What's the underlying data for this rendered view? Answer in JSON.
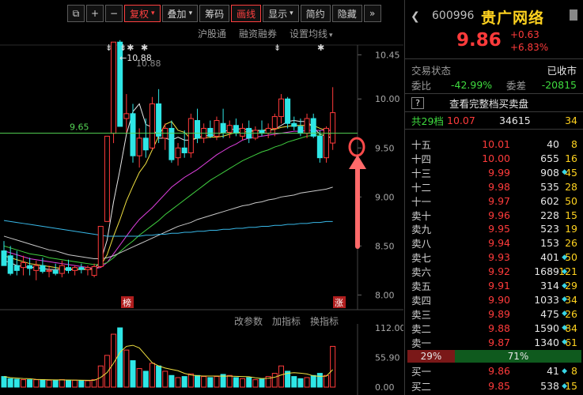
{
  "toolbar": {
    "restore_icon": "restore-icon",
    "zoom_in_icon": "plus-icon",
    "zoom_out_icon": "minus-icon",
    "fuquan": "复权",
    "diejia": "叠加",
    "chouma": "筹码",
    "huaxian": "画线",
    "xianshi": "显示",
    "jianyue": "简约",
    "yincang": "隐藏",
    "expand_icon": "double-chevron-right-icon",
    "caret": "▾"
  },
  "subtoolbar": {
    "hugutong": "沪股通",
    "rongzi": "融资融券",
    "shezhi": "设置均线"
  },
  "chart": {
    "y_ticks": [
      "10.45",
      "10.00",
      "9.50",
      "9.00",
      "8.50",
      "8.00"
    ],
    "high_label": "←10.88",
    "high_label_shadow": "10.88",
    "ref_line_label": "9.65",
    "badge_list": "榜",
    "badge_limit": "涨",
    "markers": [
      "⇟",
      "⇟✱",
      "✱",
      "⇟",
      "✱"
    ],
    "vol_ticks": [
      "112.00",
      "55.90",
      "0.00"
    ]
  },
  "chart_data": {
    "type": "candlestick",
    "y_range": [
      7.85,
      10.55
    ],
    "ref_price": 9.65,
    "candles": [
      [
        8.45,
        8.55,
        8.3,
        8.3
      ],
      [
        8.4,
        8.5,
        8.2,
        8.22
      ],
      [
        8.3,
        8.45,
        8.2,
        8.25
      ],
      [
        8.28,
        8.4,
        8.2,
        8.33
      ],
      [
        8.3,
        8.38,
        8.2,
        8.27
      ],
      [
        8.25,
        8.35,
        8.15,
        8.3
      ],
      [
        8.3,
        8.38,
        8.22,
        8.24
      ],
      [
        8.24,
        8.3,
        8.18,
        8.25
      ],
      [
        8.25,
        8.32,
        8.2,
        8.22
      ],
      [
        8.22,
        8.35,
        8.18,
        8.3
      ],
      [
        8.28,
        8.36,
        8.22,
        8.25
      ],
      [
        8.25,
        8.3,
        8.2,
        8.28
      ],
      [
        8.28,
        8.32,
        8.22,
        8.26
      ],
      [
        8.26,
        8.3,
        8.2,
        8.28
      ],
      [
        8.2,
        8.32,
        8.18,
        8.29
      ],
      [
        8.29,
        8.7,
        8.28,
        8.7
      ],
      [
        8.75,
        9.62,
        8.75,
        9.62
      ],
      [
        9.65,
        10.58,
        9.55,
        10.58
      ],
      [
        10.58,
        10.6,
        9.72,
        9.72
      ],
      [
        9.8,
        10.05,
        9.65,
        9.85
      ],
      [
        9.85,
        9.95,
        9.35,
        9.42
      ],
      [
        9.42,
        9.7,
        9.3,
        9.6
      ],
      [
        9.6,
        9.8,
        9.4,
        9.48
      ],
      [
        9.5,
        10.02,
        9.48,
        9.95
      ],
      [
        9.95,
        10.1,
        9.55,
        9.62
      ],
      [
        9.6,
        9.75,
        9.48,
        9.7
      ],
      [
        9.7,
        9.78,
        9.35,
        9.38
      ],
      [
        9.4,
        9.55,
        9.32,
        9.5
      ],
      [
        9.5,
        9.68,
        9.4,
        9.45
      ],
      [
        9.45,
        9.85,
        9.4,
        9.8
      ],
      [
        9.78,
        9.9,
        9.55,
        9.6
      ],
      [
        9.6,
        9.75,
        9.55,
        9.7
      ],
      [
        9.7,
        9.78,
        9.6,
        9.62
      ],
      [
        9.62,
        9.82,
        9.58,
        9.78
      ],
      [
        9.75,
        9.9,
        9.6,
        9.66
      ],
      [
        9.66,
        9.78,
        9.6,
        9.73
      ],
      [
        9.73,
        9.8,
        9.62,
        9.65
      ],
      [
        9.62,
        9.75,
        9.58,
        9.7
      ],
      [
        9.7,
        9.78,
        9.55,
        9.6
      ],
      [
        9.6,
        9.72,
        9.58,
        9.68
      ],
      [
        9.68,
        9.78,
        9.62,
        9.65
      ],
      [
        9.65,
        9.75,
        9.6,
        9.7
      ],
      [
        9.7,
        9.85,
        9.62,
        9.82
      ],
      [
        9.82,
        10.05,
        9.75,
        10.0
      ],
      [
        10.0,
        10.02,
        9.7,
        9.75
      ],
      [
        9.75,
        9.82,
        9.68,
        9.72
      ],
      [
        9.72,
        9.8,
        9.62,
        9.65
      ],
      [
        9.65,
        9.85,
        9.6,
        9.8
      ],
      [
        9.8,
        9.85,
        9.6,
        9.62
      ],
      [
        9.62,
        9.68,
        9.35,
        9.4
      ],
      [
        9.4,
        9.72,
        9.35,
        9.7
      ],
      [
        9.55,
        10.12,
        9.48,
        9.86
      ]
    ],
    "ma": [
      {
        "name": "MA5",
        "color": "#e8e8e8",
        "values": [
          8.35,
          8.33,
          8.3,
          8.29,
          8.28,
          8.28,
          8.27,
          8.26,
          8.26,
          8.26,
          8.26,
          8.26,
          8.26,
          8.27,
          8.27,
          8.34,
          8.56,
          8.95,
          9.28,
          9.64,
          9.87,
          9.95,
          9.74,
          9.71,
          9.6,
          9.6,
          9.58,
          9.61,
          9.58,
          9.58,
          9.6,
          9.63,
          9.62,
          9.64,
          9.66,
          9.69,
          9.69,
          9.7,
          9.68,
          9.68,
          9.68,
          9.68,
          9.69,
          9.73,
          9.77,
          9.78,
          9.77,
          9.77,
          9.71,
          9.64,
          9.62,
          9.6
        ]
      },
      {
        "name": "MA10",
        "color": "#f0e040",
        "values": [
          8.4,
          8.38,
          8.36,
          8.34,
          8.32,
          8.31,
          8.3,
          8.29,
          8.28,
          8.27,
          8.27,
          8.26,
          8.26,
          8.26,
          8.26,
          8.3,
          8.41,
          8.6,
          8.77,
          8.96,
          9.11,
          9.25,
          9.34,
          9.48,
          9.62,
          9.74,
          9.77,
          9.68,
          9.66,
          9.59,
          9.6,
          9.6,
          9.61,
          9.61,
          9.62,
          9.64,
          9.66,
          9.66,
          9.67,
          9.67,
          9.68,
          9.69,
          9.69,
          9.71,
          9.72,
          9.73,
          9.73,
          9.73,
          9.73,
          9.7,
          9.68,
          9.68
        ]
      },
      {
        "name": "MA20",
        "color": "#e040e0",
        "values": [
          8.45,
          8.43,
          8.41,
          8.39,
          8.37,
          8.36,
          8.35,
          8.34,
          8.33,
          8.32,
          8.31,
          8.3,
          8.29,
          8.28,
          8.27,
          8.28,
          8.33,
          8.42,
          8.51,
          8.6,
          8.69,
          8.77,
          8.83,
          8.89,
          8.96,
          9.03,
          9.1,
          9.15,
          9.2,
          9.24,
          9.28,
          9.33,
          9.38,
          9.43,
          9.47,
          9.51,
          9.54,
          9.58,
          9.6,
          9.61,
          9.62,
          9.63,
          9.64,
          9.65,
          9.66,
          9.67,
          9.67,
          9.68,
          9.68,
          9.68,
          9.68,
          9.68
        ]
      },
      {
        "name": "MA30",
        "color": "#40d040",
        "values": [
          8.5,
          8.48,
          8.46,
          8.44,
          8.42,
          8.41,
          8.4,
          8.38,
          8.37,
          8.36,
          8.35,
          8.34,
          8.33,
          8.32,
          8.31,
          8.31,
          8.33,
          8.38,
          8.44,
          8.5,
          8.55,
          8.61,
          8.66,
          8.71,
          8.76,
          8.82,
          8.87,
          8.92,
          8.97,
          9.02,
          9.07,
          9.12,
          9.17,
          9.21,
          9.25,
          9.29,
          9.33,
          9.37,
          9.4,
          9.43,
          9.46,
          9.48,
          9.51,
          9.53,
          9.56,
          9.58,
          9.6,
          9.62,
          9.63,
          9.63,
          9.64,
          9.64
        ]
      },
      {
        "name": "MA60",
        "color": "#c8c8c8",
        "values": [
          8.6,
          8.58,
          8.56,
          8.54,
          8.52,
          8.5,
          8.48,
          8.46,
          8.45,
          8.43,
          8.41,
          8.4,
          8.39,
          8.38,
          8.37,
          8.37,
          8.38,
          8.4,
          8.43,
          8.46,
          8.49,
          8.52,
          8.55,
          8.58,
          8.61,
          8.64,
          8.67,
          8.7,
          8.72,
          8.74,
          8.77,
          8.79,
          8.81,
          8.83,
          8.85,
          8.87,
          8.89,
          8.91,
          8.92,
          8.94,
          8.95,
          8.97,
          8.98,
          9.0,
          9.01,
          9.02,
          9.04,
          9.05,
          9.06,
          9.07,
          9.08,
          9.1
        ]
      },
      {
        "name": "MA120",
        "color": "#38b8e8",
        "values": [
          8.76,
          8.75,
          8.74,
          8.73,
          8.72,
          8.71,
          8.7,
          8.69,
          8.68,
          8.67,
          8.66,
          8.65,
          8.64,
          8.63,
          8.62,
          8.61,
          8.6,
          8.6,
          8.6,
          8.6,
          8.6,
          8.6,
          8.61,
          8.61,
          8.62,
          8.62,
          8.63,
          8.63,
          8.64,
          8.64,
          8.65,
          8.65,
          8.66,
          8.66,
          8.67,
          8.67,
          8.68,
          8.68,
          8.69,
          8.69,
          8.7,
          8.7,
          8.71,
          8.71,
          8.72,
          8.72,
          8.73,
          8.73,
          8.74,
          8.74,
          8.75,
          8.75
        ]
      }
    ],
    "volume": {
      "range": [
        0,
        112
      ],
      "values": [
        20,
        16,
        15,
        14,
        14,
        14,
        14,
        13,
        13,
        14,
        13,
        13,
        12,
        12,
        14,
        40,
        60,
        100,
        115,
        70,
        50,
        35,
        30,
        45,
        40,
        30,
        22,
        18,
        20,
        25,
        22,
        20,
        18,
        20,
        24,
        22,
        18,
        16,
        18,
        14,
        15,
        20,
        26,
        40,
        30,
        20,
        16,
        18,
        22,
        26,
        22,
        77
      ]
    }
  },
  "indicator_tools": {
    "gaicanshu": "改参数",
    "jiazhibiao": "加指标",
    "huanzhibiao": "换指标"
  },
  "panel": {
    "code": "600996",
    "name": "贵广网络",
    "price": "9.86",
    "change": "+0.63",
    "change_pct": "+6.83%",
    "status_label": "交易状态",
    "status_value": "已收市",
    "weibi_label": "委比",
    "weibi_value": "-42.99%",
    "weicha_label": "委差",
    "weicha_value": "-20815",
    "help_btn": "?",
    "full_depth": "查看完整档买卖盘",
    "summary": {
      "label": "共29档",
      "price": "10.07",
      "vol": "34615",
      "cnt": "34"
    },
    "asks": [
      {
        "label": "十五",
        "price": "10.01",
        "vol": "40",
        "dia": false,
        "cnt": "8"
      },
      {
        "label": "十四",
        "price": "10.00",
        "vol": "655",
        "dia": false,
        "cnt": "16"
      },
      {
        "label": "十三",
        "price": "9.99",
        "vol": "908",
        "dia": true,
        "cnt": "45"
      },
      {
        "label": "十二",
        "price": "9.98",
        "vol": "535",
        "dia": false,
        "cnt": "28"
      },
      {
        "label": "十一",
        "price": "9.97",
        "vol": "602",
        "dia": false,
        "cnt": "50"
      },
      {
        "label": "卖十",
        "price": "9.96",
        "vol": "228",
        "dia": false,
        "cnt": "15"
      },
      {
        "label": "卖九",
        "price": "9.95",
        "vol": "523",
        "dia": false,
        "cnt": "19"
      },
      {
        "label": "卖八",
        "price": "9.94",
        "vol": "153",
        "dia": false,
        "cnt": "26"
      },
      {
        "label": "卖七",
        "price": "9.93",
        "vol": "401",
        "dia": true,
        "cnt": "50"
      },
      {
        "label": "卖六",
        "price": "9.92",
        "vol": "1689",
        "dia": true,
        "cnt": "121"
      },
      {
        "label": "卖五",
        "price": "9.91",
        "vol": "314",
        "dia": true,
        "cnt": "29"
      },
      {
        "label": "卖四",
        "price": "9.90",
        "vol": "1033",
        "dia": true,
        "cnt": "34"
      },
      {
        "label": "卖三",
        "price": "9.89",
        "vol": "475",
        "dia": true,
        "cnt": "26"
      },
      {
        "label": "卖二",
        "price": "9.88",
        "vol": "1590",
        "dia": true,
        "cnt": "84"
      },
      {
        "label": "卖一",
        "price": "9.87",
        "vol": "1340",
        "dia": true,
        "cnt": "61"
      }
    ],
    "ratio": {
      "sell": "29%",
      "buy": "71%"
    },
    "bids": [
      {
        "label": "买一",
        "price": "9.86",
        "vol": "41",
        "dia": true,
        "cnt": "8"
      },
      {
        "label": "买二",
        "price": "9.85",
        "vol": "538",
        "dia": true,
        "cnt": "15"
      }
    ]
  }
}
